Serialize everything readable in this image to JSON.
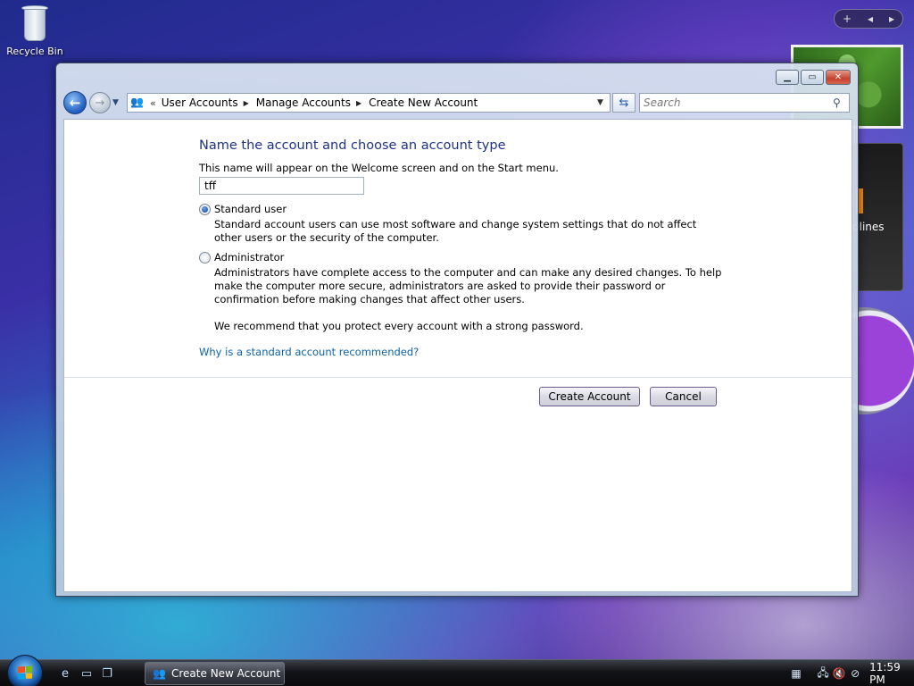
{
  "desktop": {
    "recycle_bin_label": "Recycle Bin",
    "gadget_feed_text": "dlines"
  },
  "window": {
    "address": {
      "crumbs": [
        "User Accounts",
        "Manage Accounts",
        "Create New Account"
      ]
    },
    "search": {
      "placeholder": "Search"
    },
    "content": {
      "heading": "Name the account and choose an account type",
      "hint": "This name will appear on the Welcome screen and on the Start menu.",
      "account_name_value": "tff",
      "standard": {
        "label": "Standard user",
        "selected": true,
        "description": "Standard account users can use most software and change system settings that do not affect other users or the security of the computer."
      },
      "administrator": {
        "label": "Administrator",
        "selected": false,
        "description": "Administrators have complete access to the computer and can make any desired changes. To help make the computer more secure, administrators are asked to provide their password or confirmation before making changes that affect other users."
      },
      "recommendation": "We recommend that you protect every account with a strong password.",
      "why_link": "Why is a standard account recommended?",
      "create_button": "Create Account",
      "cancel_button": "Cancel"
    }
  },
  "taskbar": {
    "active_task": "Create New Account",
    "clock": "11:59 PM"
  },
  "colors": {
    "heading": "#1e3287",
    "link": "#0b62a6",
    "close_button": "#c4422e"
  }
}
